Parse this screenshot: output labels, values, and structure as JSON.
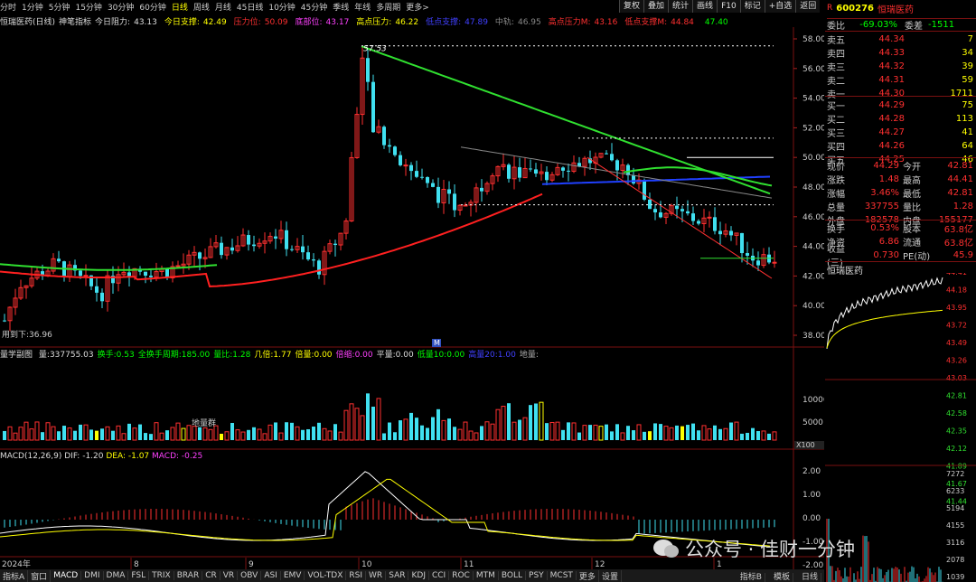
{
  "toolbar": {
    "periods": [
      "分时",
      "1分钟",
      "5分钟",
      "15分钟",
      "30分钟",
      "60分钟",
      "日线",
      "周线",
      "月线",
      "45日线",
      "10分钟",
      "45分钟",
      "季线",
      "年线",
      "多周期",
      "更多>"
    ],
    "active_period": "日线",
    "right_buttons": [
      "复权",
      "叠加",
      "统计",
      "画线",
      "F10",
      "标记",
      "+自选",
      "返回"
    ]
  },
  "indicator_bar": {
    "name": "恒瑞医药(日线)",
    "indicator": "神笔指标",
    "items": [
      {
        "label": "今日阻力:",
        "value": "43.13",
        "color": "#dddddd"
      },
      {
        "label": "今日支撑:",
        "value": "42.49",
        "color": "#ffff00"
      },
      {
        "label": "压力位:",
        "value": "50.09",
        "color": "#ff3030"
      },
      {
        "label": "底部位:",
        "value": "43.17",
        "color": "#ff40ff"
      },
      {
        "label": "高点压力:",
        "value": "46.22",
        "color": "#ffff00"
      },
      {
        "label": "低点支撑:",
        "value": "47.89",
        "color": "#4040ff"
      },
      {
        "label": "中轨:",
        "value": "46.95",
        "color": "#888888"
      },
      {
        "label": "高点压力M:",
        "value": "43.16",
        "color": "#ff3030"
      },
      {
        "label": "低点支撑M:",
        "value": "44.84",
        "color": "#ff3030"
      },
      {
        "label": "",
        "value": "47.40",
        "color": "#00ff00"
      }
    ]
  },
  "price_axis": [
    "58.00",
    "56.00",
    "54.00",
    "52.00",
    "50.00",
    "48.00",
    "46.00",
    "44.00",
    "42.00",
    "40.00",
    "38.00"
  ],
  "chart_labels": {
    "high_marker": "57.53",
    "low_marker": "用到下:36.96",
    "month_marker": "M"
  },
  "volume_bar": {
    "label": "量学副图",
    "items": [
      {
        "label": "量:",
        "value": "337755.03",
        "color": "#dddddd"
      },
      {
        "label": "换手:",
        "value": "0.53",
        "color": "#00ff00"
      },
      {
        "label": "全换手周期:",
        "value": "185.00",
        "color": "#00ff00"
      },
      {
        "label": "量比:",
        "value": "1.28",
        "color": "#00ff00"
      },
      {
        "label": "几倍:",
        "value": "1.77",
        "color": "#ffff00"
      },
      {
        "label": "倍量:",
        "value": "0.00",
        "color": "#ffff00"
      },
      {
        "label": "倍缩:",
        "value": "0.00",
        "color": "#ff40ff"
      },
      {
        "label": "平量:",
        "value": "0.00",
        "color": "#dddddd"
      },
      {
        "label": "低量10:",
        "value": "0.00",
        "color": "#00ff00"
      },
      {
        "label": "高量20:",
        "value": "1.00",
        "color": "#4040ff"
      },
      {
        "label": "地量:",
        "value": "",
        "color": "#aaaaaa"
      }
    ],
    "axis": [
      "10000",
      "5000"
    ],
    "unit": "X100",
    "ground_label": "地量群"
  },
  "macd_bar": {
    "label": "MACD(12,26,9)",
    "dif": "DIF: -1.20",
    "dea": "DEA: -1.07",
    "macd": "MACD: -0.25",
    "axis": [
      "2.00",
      "1.00",
      "0.00",
      "-1.00",
      "-2.00"
    ]
  },
  "date_axis": {
    "year": "2024年",
    "months": [
      "8",
      "9",
      "10",
      "11",
      "12",
      "1"
    ]
  },
  "bottom_tabs": [
    "指标A",
    "窗口",
    "MACD",
    "DMI",
    "DMA",
    "FSL",
    "TRIX",
    "BRAR",
    "CR",
    "VR",
    "OBV",
    "ASI",
    "EMV",
    "VOL-TDX",
    "RSI",
    "WR",
    "SAR",
    "KDJ",
    "CCI",
    "ROC",
    "MTM",
    "BOLL",
    "PSY",
    "MCST",
    "更多",
    "设置"
  ],
  "bottom_right": [
    "指标B",
    "模板",
    "日线"
  ],
  "quote": {
    "code": "600276",
    "name": "恒瑞医药",
    "ratio_label": "委比",
    "ratio": "-69.03%",
    "diff_label": "委差",
    "diff": "-1511",
    "asks": [
      {
        "label": "卖五",
        "price": "44.34",
        "vol": "7"
      },
      {
        "label": "卖四",
        "price": "44.33",
        "vol": "34"
      },
      {
        "label": "卖三",
        "price": "44.32",
        "vol": "39"
      },
      {
        "label": "卖二",
        "price": "44.31",
        "vol": "59"
      },
      {
        "label": "卖一",
        "price": "44.30",
        "vol": "1711"
      }
    ],
    "bids": [
      {
        "label": "买一",
        "price": "44.29",
        "vol": "75"
      },
      {
        "label": "买二",
        "price": "44.28",
        "vol": "113"
      },
      {
        "label": "买三",
        "price": "44.27",
        "vol": "41"
      },
      {
        "label": "买四",
        "price": "44.26",
        "vol": "64"
      },
      {
        "label": "买五",
        "price": "44.25",
        "vol": "46"
      }
    ],
    "stats": [
      {
        "l1": "现价",
        "v1": "44.29",
        "l2": "今开",
        "v2": "42.81"
      },
      {
        "l1": "涨跌",
        "v1": "1.48",
        "l2": "最高",
        "v2": "44.41"
      },
      {
        "l1": "涨幅",
        "v1": "3.46%",
        "l2": "最低",
        "v2": "42.81"
      },
      {
        "l1": "总量",
        "v1": "337755",
        "l2": "量比",
        "v2": "1.28"
      },
      {
        "l1": "外盘",
        "v1": "182578",
        "l2": "内盘",
        "v2": "155177"
      }
    ],
    "stats2": [
      {
        "l1": "换手",
        "v1": "0.53%",
        "l2": "股本",
        "v2": "63.8亿"
      },
      {
        "l1": "净资",
        "v1": "6.86",
        "l2": "流通",
        "v2": "63.8亿"
      },
      {
        "l1": "收益(三)",
        "v1": "0.730",
        "l2": "PE(动)",
        "v2": "45.9"
      }
    ],
    "mini_title": "恒瑞医药",
    "mini_axis": [
      "44.41",
      "44.18",
      "43.95",
      "43.72",
      "43.49",
      "43.26",
      "43.03",
      "42.81",
      "42.58",
      "42.35",
      "42.12",
      "41.89",
      "41.67",
      "41.44"
    ],
    "mini_vol_axis": [
      "7272",
      "6233",
      "5194",
      "4155",
      "3116",
      "2078",
      "1039"
    ]
  },
  "watermark": "公众号 · 佳财一分钟"
}
